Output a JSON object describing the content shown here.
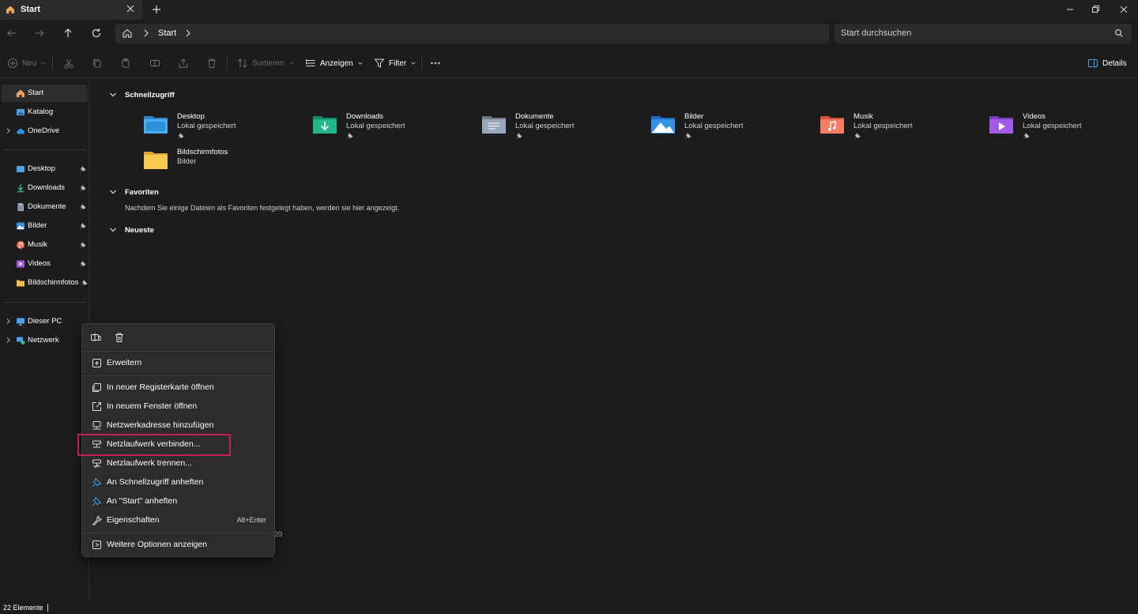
{
  "window": {
    "tab_title": "Start",
    "controls": [
      "minimize",
      "maximize",
      "close"
    ]
  },
  "navigation": {
    "breadcrumb": "Start",
    "search_placeholder": "Start durchsuchen"
  },
  "toolbar": {
    "new_label": "Neu",
    "sort_label": "Sortieren",
    "view_label": "Anzeigen",
    "filter_label": "Filter",
    "details_label": "Details"
  },
  "sidebar": {
    "top": [
      {
        "label": "Start",
        "icon": "home-icon",
        "color": "#f0a35c",
        "active": true
      },
      {
        "label": "Katalog",
        "icon": "gallery-icon",
        "color": "#4aa3e8"
      },
      {
        "label": "OneDrive",
        "icon": "cloud-icon",
        "color": "#2f8fe0",
        "expandable": true
      }
    ],
    "pinned": [
      {
        "label": "Desktop",
        "color": "#4aa3e8"
      },
      {
        "label": "Downloads",
        "color": "#2fbf8a"
      },
      {
        "label": "Dokumente",
        "color": "#9aa8bb"
      },
      {
        "label": "Bilder",
        "color": "#3b8de0"
      },
      {
        "label": "Musik",
        "color": "#f06a4a"
      },
      {
        "label": "Videos",
        "color": "#a25ce0"
      },
      {
        "label": "Bildschirmfotos",
        "color": "#f2c04a"
      }
    ],
    "bottom": [
      {
        "label": "Dieser PC",
        "color": "#4aa3e8"
      },
      {
        "label": "Netzwerk",
        "color": "#4aa3e8"
      }
    ]
  },
  "main": {
    "quick_access_title": "Schnellzugriff",
    "quick_access": [
      {
        "name": "Desktop",
        "sub": "Lokal gespeichert",
        "color": "#3fa0e8",
        "pinned": true
      },
      {
        "name": "Downloads",
        "sub": "Lokal gespeichert",
        "color": "#1fb58a",
        "pinned": true
      },
      {
        "name": "Dokumente",
        "sub": "Lokal gespeichert",
        "color": "#8f9db0",
        "pinned": true
      },
      {
        "name": "Bilder",
        "sub": "Lokal gespeichert",
        "color": "#2f8fe0",
        "pinned": true
      },
      {
        "name": "Musik",
        "sub": "Lokal gespeichert",
        "color": "#f0735a",
        "pinned": true
      },
      {
        "name": "Videos",
        "sub": "Lokal gespeichert",
        "color": "#9d55e0",
        "pinned": true
      },
      {
        "name": "Bildschirmfotos",
        "sub": "Bilder",
        "color": "#f5c54a",
        "pinned": false
      }
    ],
    "favorites_title": "Favoriten",
    "favorites_empty": "Nachdem Sie einige Dateien als Favoriten festgelegt haben, werden sie hier angezeigt.",
    "recent_title": "Neueste",
    "stray_text": "20"
  },
  "context_menu": {
    "top_icons": [
      "copy-path-icon",
      "delete-icon"
    ],
    "items": [
      {
        "label": "Erweitern",
        "icon": "expand-icon"
      },
      {
        "label": "In neuer Registerkarte öffnen",
        "icon": "new-tab-icon"
      },
      {
        "label": "In neuem Fenster öffnen",
        "icon": "new-window-icon"
      },
      {
        "label": "Netzwerkadresse hinzufügen",
        "icon": "network-location-icon"
      },
      {
        "label": "Netzlaufwerk verbinden...",
        "icon": "map-drive-icon",
        "highlighted": true
      },
      {
        "label": "Netzlaufwerk trennen...",
        "icon": "disconnect-drive-icon"
      },
      {
        "label": "An Schnellzugriff anheften",
        "icon": "pin-icon"
      },
      {
        "label": "An \"Start\" anheften",
        "icon": "pin-icon"
      },
      {
        "label": "Eigenschaften",
        "icon": "wrench-icon",
        "shortcut": "Alt+Enter"
      },
      {
        "label": "Weitere Optionen anzeigen",
        "icon": "more-options-icon"
      }
    ],
    "highlight_color": "#c4214f"
  },
  "status_bar": {
    "item_count": "22 Elemente"
  }
}
